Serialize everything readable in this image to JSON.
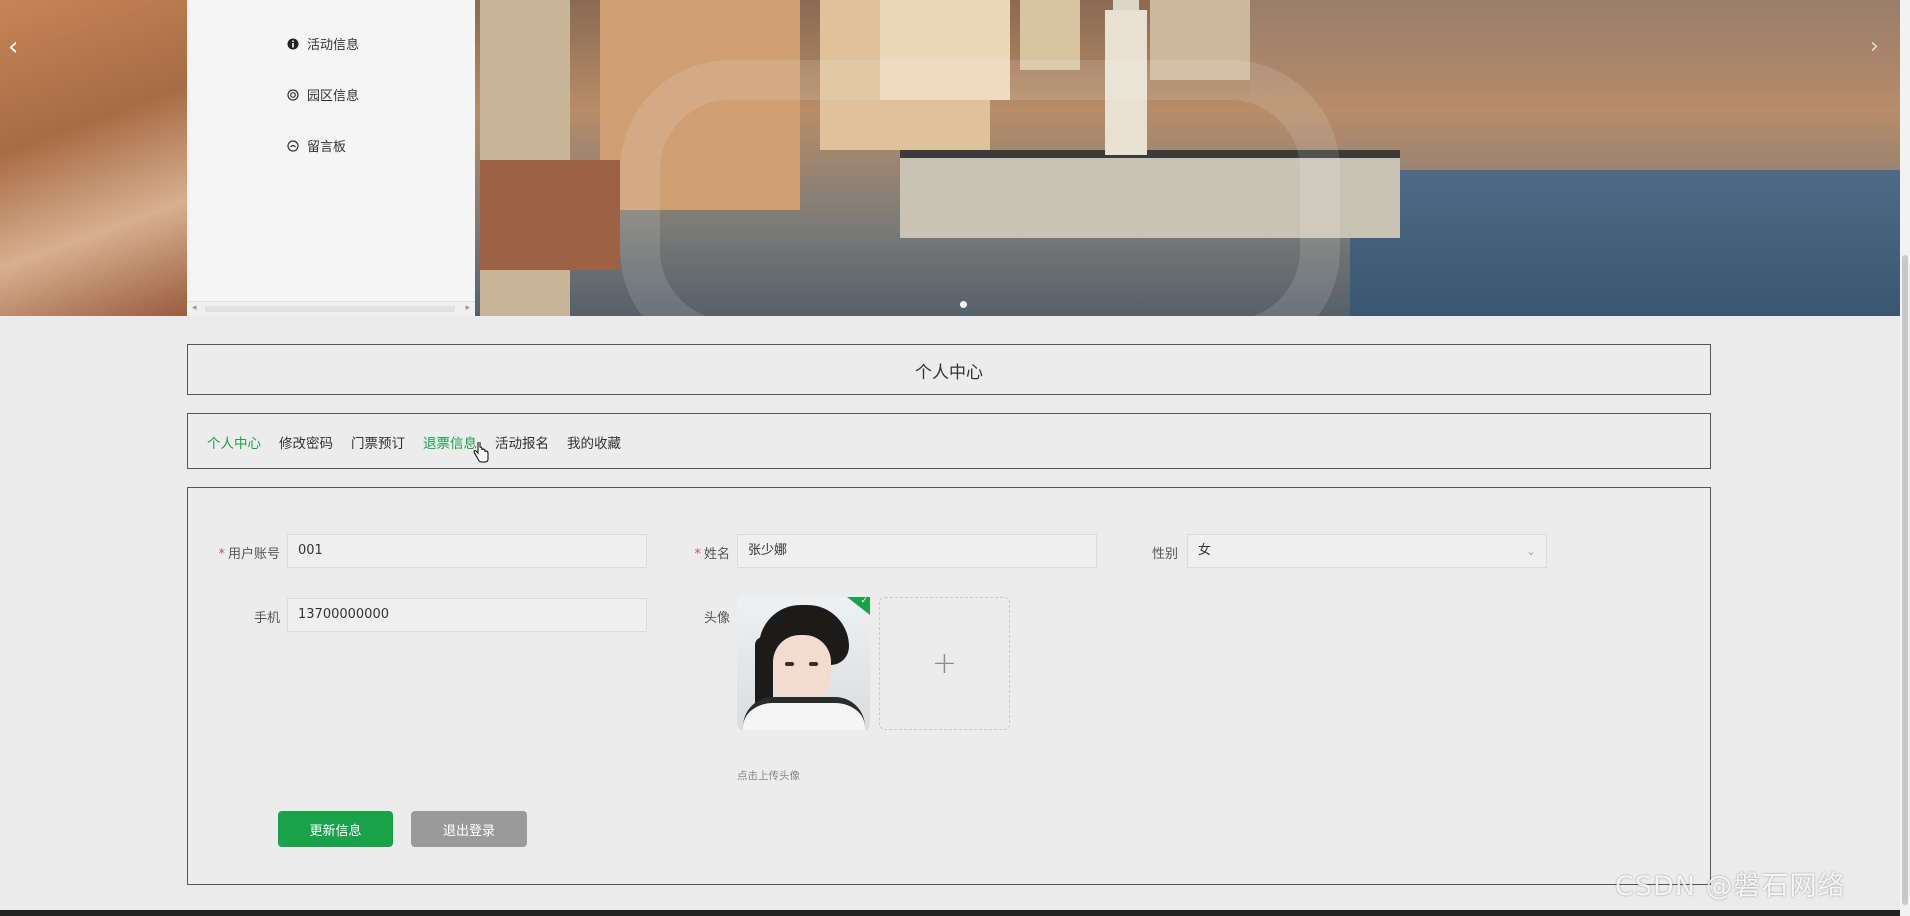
{
  "nav": {
    "arrow_prev": "‹",
    "arrow_next": "›",
    "menu_items": [
      {
        "icon": "info-circle-icon",
        "glyph": "i",
        "label": "活动信息"
      },
      {
        "icon": "target-icon",
        "glyph": "◎",
        "label": "园区信息"
      },
      {
        "icon": "message-icon",
        "glyph": "◔",
        "label": "留言板"
      }
    ],
    "scroll_left": "◂",
    "scroll_right": "▸"
  },
  "page": {
    "title": "个人中心"
  },
  "tabs": [
    {
      "label": "个人中心",
      "state": "active"
    },
    {
      "label": "修改密码",
      "state": "normal"
    },
    {
      "label": "门票预订",
      "state": "normal"
    },
    {
      "label": "退票信息",
      "state": "hover"
    },
    {
      "label": "活动报名",
      "state": "normal"
    },
    {
      "label": "我的收藏",
      "state": "normal"
    }
  ],
  "form": {
    "username": {
      "label": "用户账号",
      "required": "*",
      "value": "001"
    },
    "name": {
      "label": "姓名",
      "required": "*",
      "value": "张少娜"
    },
    "gender": {
      "label": "性别",
      "value": "女",
      "arrow": "⌄"
    },
    "phone": {
      "label": "手机",
      "value": "13700000000"
    },
    "avatar": {
      "label": "头像",
      "upload_plus": "+",
      "hint": "点击上传头像",
      "check": "✓"
    }
  },
  "buttons": {
    "update": "更新信息",
    "logout": "退出登录"
  },
  "watermark": "CSDN @磐石网络",
  "colors": {
    "accent": "#1aa24a",
    "required": "#e04a4a",
    "logout_button": "#9a9a9a"
  }
}
